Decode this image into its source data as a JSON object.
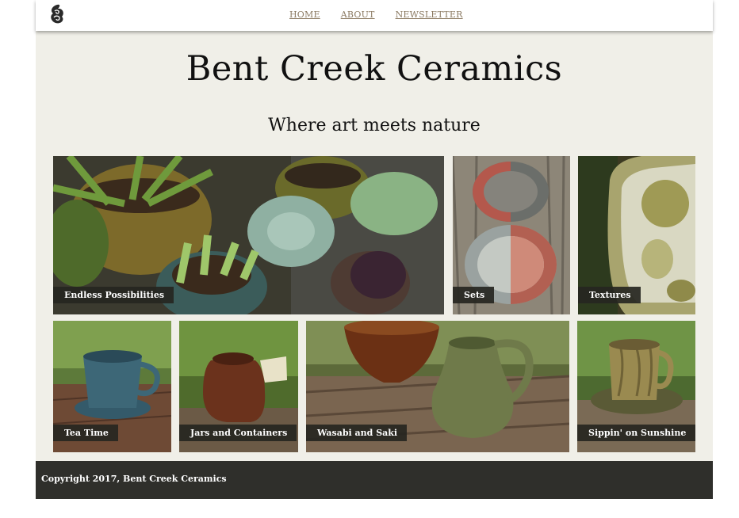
{
  "nav": {
    "logo_icon": "swirl-logo-icon",
    "links": [
      "HOME",
      "ABOUT",
      "NEWSLETTER"
    ]
  },
  "header": {
    "title": "Bent Creek Ceramics",
    "tagline": "Where art meets nature"
  },
  "gallery": {
    "tiles": [
      {
        "label": "Endless Possibilities"
      },
      {
        "label": "Sets"
      },
      {
        "label": "Textures"
      },
      {
        "label": "Tea Time"
      },
      {
        "label": "Jars and Containers"
      },
      {
        "label": "Wasabi and Saki"
      },
      {
        "label": "Sippin' on Sunshine"
      }
    ]
  },
  "footer": {
    "copyright": "Copyright 2017, Bent Creek Ceramics"
  },
  "colors": {
    "page_background": "#f0efe8",
    "caption_background": "#262621",
    "footer_background": "#2f2f2b",
    "nav_link": "#8b7a62"
  }
}
